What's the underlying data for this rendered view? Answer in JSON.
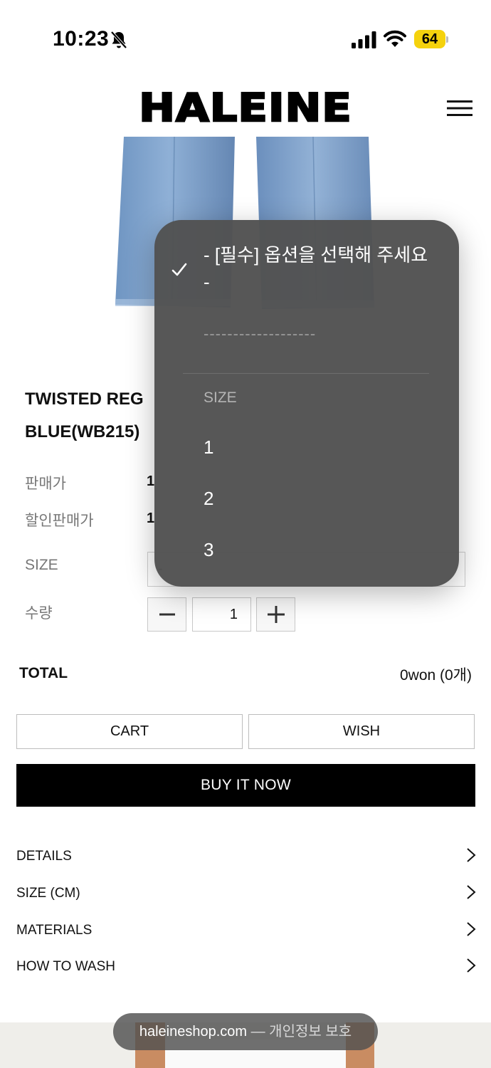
{
  "status_bar": {
    "time": "10:23",
    "battery": "64"
  },
  "header": {
    "logo": "HALEINE"
  },
  "product": {
    "title_line1": "TWISTED REG",
    "title_line2": "BLUE(WB215)",
    "price_label": "판매가",
    "price_value": "1",
    "sale_price_label": "할인판매가",
    "sale_price_value": "1",
    "size_label": "SIZE",
    "size_select_value": "-",
    "qty_label": "수량",
    "qty_value": "1",
    "qty_minus": "−",
    "qty_plus": "+"
  },
  "total": {
    "label": "TOTAL",
    "value": "0won (0개)"
  },
  "buttons": {
    "cart": "CART",
    "wish": "WISH",
    "buy": "BUY IT NOW"
  },
  "accordion": [
    {
      "label": "DETAILS"
    },
    {
      "label": "SIZE (CM)"
    },
    {
      "label": "MATERIALS"
    },
    {
      "label": "HOW TO WASH"
    }
  ],
  "dropdown": {
    "selected": "- [필수] 옵션을 선택해 주세요 -",
    "separator": "-------------------",
    "group_label": "SIZE",
    "options": [
      "1",
      "2",
      "3"
    ]
  },
  "browser_bar": {
    "domain": "haleineshop.com",
    "suffix": "— 개인정보 보호"
  },
  "colors": {
    "accent_battery": "#f5d20d",
    "buy_button": "#000000",
    "dropdown_bg": "#525252"
  }
}
